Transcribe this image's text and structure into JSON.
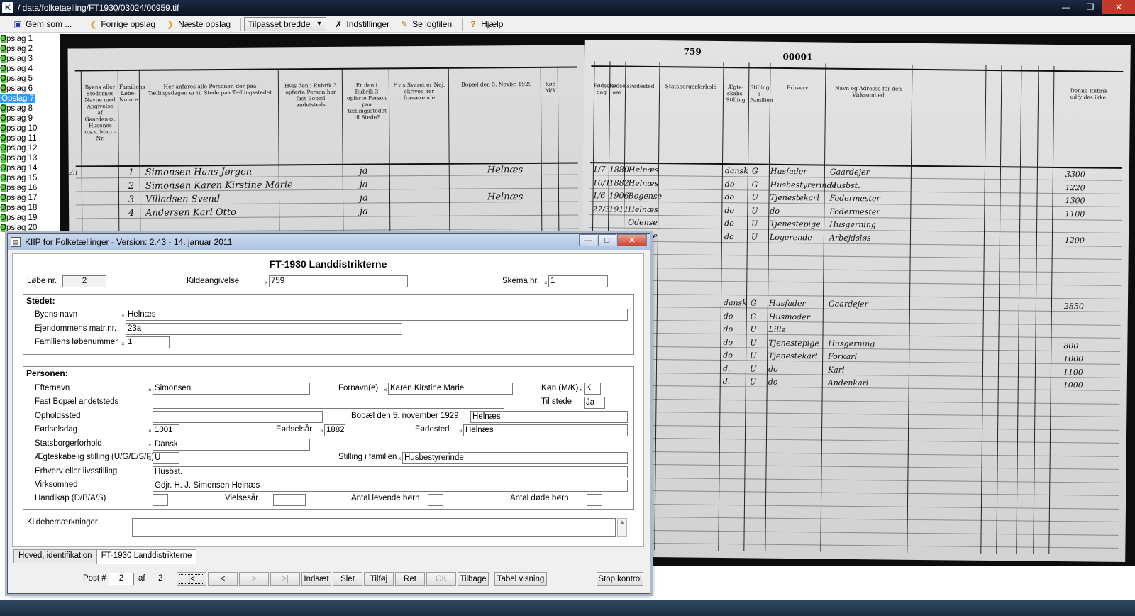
{
  "window": {
    "title": "/ data/folketaelling/FT1930/03024/00959.tif",
    "app_icon": "K"
  },
  "toolbar": {
    "save": "Gem som ...",
    "prev": "Forrige opslag",
    "next": "Næste opslag",
    "fit": "Tilpasset bredde",
    "settings": "Indstillinger",
    "log": "Se logfilen",
    "help": "Hjælp"
  },
  "pagelist": [
    "Opslag 1",
    "Opslag 2",
    "Opslag 3",
    "Opslag 4",
    "Opslag 5",
    "Opslag 6",
    "Opslag 7",
    "Opslag 8",
    "Opslag 9",
    "Opslag 10",
    "Opslag 11",
    "Opslag 12",
    "Opslag 13",
    "Opslag 14",
    "Opslag 15",
    "Opslag 16",
    "Opslag 17",
    "Opslag 18",
    "Opslag 19",
    "Opslag 20"
  ],
  "pagelist_selected": 6,
  "census": {
    "page_number": "759",
    "stamp": "00001",
    "row_marker": "23",
    "names": [
      "Simonsen Hans Jørgen",
      "Simonsen Karen Kirstine Marie",
      "Villadsen Svend",
      "Andersen Karl Otto"
    ],
    "numbers": [
      "1",
      "2",
      "3",
      "4"
    ],
    "ja": [
      "ja",
      "ja",
      "ja",
      "ja"
    ],
    "place": [
      "Helnæs",
      "Helnæs"
    ],
    "headers_left": [
      "Byens eller Stedernes Navne med Angivelse af Gaardenes, Husenes o.s.v. Matr.-Nr.",
      "Familiens Løbe-Numre",
      "Her anføres alle Personer, der paa Tællingsdagen er til Stede paa Tællingsstedet",
      "Hvis den i Rubrik 3 opførte Person har fast Bopæl andetsteds",
      "Er den i Rubrik 3 opførte Person paa Tællingsstedet til Stede?",
      "Hvis Svaret er Nej, skrives her fraværende",
      "Bopæl den 5. Novbr. 1929",
      "Køn M/K"
    ],
    "headers_right": [
      "Fødsels-dag",
      "Fødsels-aar",
      "Fødested",
      "Statsborgerforhold",
      "Ægte-skabs-Stilling",
      "Stilling i Familien",
      "Erhverv",
      "Navn og Adresse for den Virksomhed",
      "Denne Rubrik udfyldes ikke."
    ],
    "right_rows": [
      {
        "day": "1/7",
        "year": "1880",
        "place": "Helnæs",
        "status": "dansk",
        "civil": "G",
        "fam": "Husfader",
        "job": "Gaardejer",
        "amount": "3300"
      },
      {
        "day": "10/1",
        "year": "1882",
        "place": "Helnæs",
        "status": "do",
        "civil": "G",
        "fam": "Husbestyrerinde",
        "job": "Husbst.",
        "amount": "1220"
      },
      {
        "day": "1/6",
        "year": "1906",
        "place": "Bogense",
        "status": "do",
        "civil": "U",
        "fam": "Tjenestekarl",
        "job": "Fodermester",
        "amount": "1300"
      },
      {
        "day": "27/3",
        "year": "1911",
        "place": "Helnæs",
        "status": "do",
        "civil": "U",
        "fam": "do",
        "job": "Fodermester",
        "amount": "1100"
      },
      {
        "day": "",
        "year": "",
        "place": "Odense",
        "status": "do",
        "civil": "U",
        "fam": "Tjenestepige",
        "job": "Husgerning",
        "amount": ""
      },
      {
        "day": "",
        "year": "",
        "place": "Odense",
        "status": "do",
        "civil": "U",
        "fam": "Logerende",
        "job": "Arbejdsløs",
        "amount": "1200"
      },
      {
        "day": "",
        "year": "",
        "place": "",
        "status": "dansk",
        "civil": "G",
        "fam": "Husfader",
        "job": "Gaardejer",
        "amount": "2850"
      },
      {
        "day": "",
        "year": "",
        "place": "",
        "status": "do",
        "civil": "G",
        "fam": "Husmoder",
        "job": "",
        "amount": ""
      },
      {
        "day": "",
        "year": "",
        "place": "",
        "status": "do",
        "civil": "U",
        "fam": "Lille",
        "job": "",
        "amount": ""
      },
      {
        "day": "",
        "year": "",
        "place": "",
        "status": "do",
        "civil": "U",
        "fam": "Tjenestepige",
        "job": "Husgerning",
        "amount": "800"
      },
      {
        "day": "",
        "year": "",
        "place": "",
        "status": "do",
        "civil": "U",
        "fam": "Tjenestekarl",
        "job": "Forkarl",
        "amount": "1000"
      },
      {
        "day": "",
        "year": "",
        "place": "",
        "status": "d.",
        "civil": "U",
        "fam": "do",
        "job": "Karl",
        "amount": "1100"
      },
      {
        "day": "",
        "year": "",
        "place": "",
        "status": "d.",
        "civil": "U",
        "fam": "do",
        "job": "Andenkarl",
        "amount": "1000"
      }
    ]
  },
  "dialog": {
    "title": "KIIP for Folketællinger - Version: 2.43 - 14. januar 2011",
    "form_title": "FT-1930 Landdistrikterne",
    "loebe_label": "Løbe nr.",
    "loebe": "2",
    "kilde_label": "Kildeangivelse",
    "kilde": "759",
    "skema_label": "Skema nr.",
    "skema": "1",
    "stedet": {
      "title": "Stedet:",
      "byens_label": "Byens navn",
      "byens": "Helnæs",
      "matr_label": "Ejendommens matr.nr.",
      "matr": "23a",
      "fam_label": "Familiens løbenummer",
      "fam": "1"
    },
    "personen": {
      "title": "Personen:",
      "efternavn_label": "Efternavn",
      "efternavn": "Simonsen",
      "fornavn_label": "Fornavn(e)",
      "fornavn": "Karen Kirstine Marie",
      "koen_label": "Køn (M/K)",
      "koen": "K",
      "fast_label": "Fast Bopæl andetsteds",
      "fast": "",
      "tilstede_label": "Til stede",
      "tilstede": "Ja",
      "ophold_label": "Opholdssted",
      "ophold": "",
      "bopael_label": "Bopæl den 5. november 1929",
      "bopael": "Helnæs",
      "foedselsdag_label": "Fødselsdag",
      "foedselsdag": "1001",
      "foedselsaar_label": "Fødselsår",
      "foedselsaar": "1882",
      "foedested_label": "Fødested",
      "foedested": "Helnæs",
      "stats_label": "Statsborgerforhold",
      "stats": "Dansk",
      "aegte_label": "Ægteskabelig stilling (U/G/E/S/F)",
      "aegte": "U",
      "stilling_label": "Stilling i familien",
      "stilling": "Husbestyrerinde",
      "erhverv_label": "Erhverv eller livsstilling",
      "erhverv": "Husbst.",
      "virksomhed_label": "Virksomhed",
      "virksomhed": "Gdjr. H. J. Simonsen Helnæs",
      "handikap_label": "Handikap (D/B/A/S)",
      "handikap": "",
      "vielse_label": "Vielsesår",
      "vielse": "",
      "levende_label": "Antal levende børn",
      "levende": "",
      "doede_label": "Antal døde børn",
      "doede": ""
    },
    "kilde_bem_label": "Kildebemærkninger",
    "kilde_bem": "",
    "tabs": [
      "Hoved, identifikation",
      "FT-1930 Landdistrikterne"
    ],
    "nav": {
      "post_label": "Post #",
      "post": "2",
      "af_label": "af",
      "total": "2",
      "first": "|<",
      "prev": "<",
      "next": ">",
      "last": ">|",
      "insert": "Indsæt",
      "delete": "Slet",
      "add": "Tilføj",
      "edit": "Ret",
      "ok": "OK",
      "back": "Tilbage",
      "table": "Tabel visning",
      "stop": "Stop kontrol"
    }
  }
}
